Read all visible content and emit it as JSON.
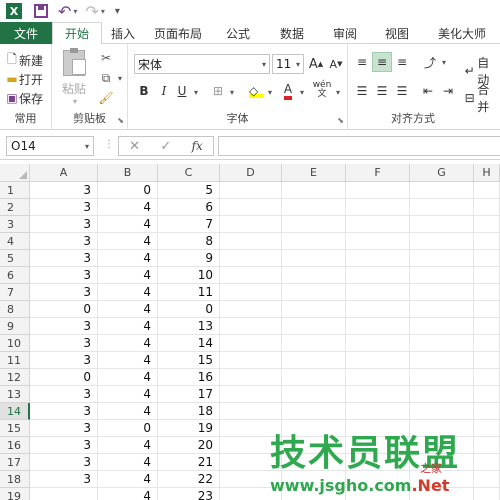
{
  "titlebar": {
    "logo": "X"
  },
  "tabs": [
    "文件",
    "开始",
    "插入",
    "页面布局",
    "公式",
    "数据",
    "审阅",
    "视图",
    "美化大师"
  ],
  "ribbon": {
    "group_common": {
      "label": "常用",
      "new": "新建",
      "open": "打开",
      "save": "保存"
    },
    "group_clipboard": {
      "label": "剪贴板",
      "paste": "粘贴"
    },
    "group_font": {
      "label": "字体",
      "font_name": "宋体",
      "font_size": "11",
      "bold": "B",
      "italic": "I",
      "underline": "U",
      "grow": "A",
      "shrink": "A",
      "phonetic": "wén"
    },
    "group_align": {
      "label": "对齐方式",
      "wrap": "自动",
      "merge": "合并"
    }
  },
  "formula_bar": {
    "name_box": "O14",
    "cancel": "✕",
    "confirm": "✓",
    "fx": "fx",
    "formula": ""
  },
  "grid": {
    "columns": [
      "A",
      "B",
      "C",
      "D",
      "E",
      "F",
      "G",
      "H"
    ],
    "rows": [
      {
        "n": "1",
        "a": "3",
        "b": "0",
        "c": "5"
      },
      {
        "n": "2",
        "a": "3",
        "b": "4",
        "c": "6"
      },
      {
        "n": "3",
        "a": "3",
        "b": "4",
        "c": "7"
      },
      {
        "n": "4",
        "a": "3",
        "b": "4",
        "c": "8"
      },
      {
        "n": "5",
        "a": "3",
        "b": "4",
        "c": "9"
      },
      {
        "n": "6",
        "a": "3",
        "b": "4",
        "c": "10"
      },
      {
        "n": "7",
        "a": "3",
        "b": "4",
        "c": "11"
      },
      {
        "n": "8",
        "a": "0",
        "b": "4",
        "c": "0"
      },
      {
        "n": "9",
        "a": "3",
        "b": "4",
        "c": "13"
      },
      {
        "n": "10",
        "a": "3",
        "b": "4",
        "c": "14"
      },
      {
        "n": "11",
        "a": "3",
        "b": "4",
        "c": "15"
      },
      {
        "n": "12",
        "a": "0",
        "b": "4",
        "c": "16"
      },
      {
        "n": "13",
        "a": "3",
        "b": "4",
        "c": "17"
      },
      {
        "n": "14",
        "a": "3",
        "b": "4",
        "c": "18"
      },
      {
        "n": "15",
        "a": "3",
        "b": "0",
        "c": "19"
      },
      {
        "n": "16",
        "a": "3",
        "b": "4",
        "c": "20"
      },
      {
        "n": "17",
        "a": "3",
        "b": "4",
        "c": "21"
      },
      {
        "n": "18",
        "a": "3",
        "b": "4",
        "c": "22"
      },
      {
        "n": "19",
        "a": "",
        "b": "4",
        "c": "23"
      }
    ],
    "selected_row": "14"
  },
  "watermark": {
    "title": "技术员联盟",
    "url_main": "www.jsgho.com",
    "url_suffix": ".Net",
    "sub": "之家"
  },
  "colors": {
    "excel_green": "#217346",
    "selection_green": "#c7e3cf",
    "watermark_green": "#2fa84f",
    "watermark_red": "#d23c2b"
  }
}
